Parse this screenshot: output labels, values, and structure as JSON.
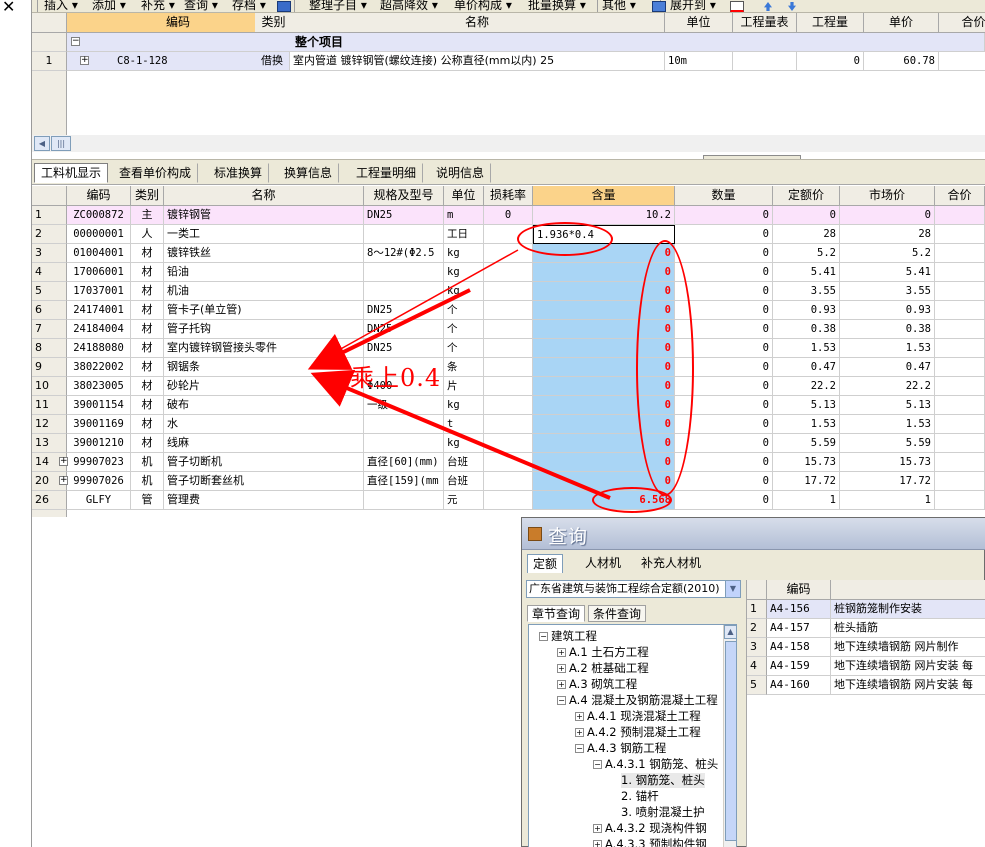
{
  "toolbar": {
    "close_glyph": "✕",
    "items": [
      "插入 ▾",
      "添加 ▾",
      "补充 ▾",
      "查询 ▾",
      "存档 ▾",
      "整理子目 ▾",
      "超高降效 ▾",
      "单价构成 ▾",
      "批量换算 ▾",
      "其他 ▾",
      "展开到 ▾"
    ]
  },
  "top_grid": {
    "headers": [
      "编码",
      "类别",
      "名称",
      "单位",
      "工程量表",
      "工程量",
      "单价",
      "合价"
    ],
    "group_row": {
      "expander": "−",
      "name": "整个项目"
    },
    "rows": [
      {
        "num": "1",
        "expander": "+",
        "code": "C8-1-128",
        "type": "借换",
        "name": "室内管道 镀锌钢管(螺纹连接) 公称直径(mm以内) 25",
        "unit": "10m",
        "qty": "0",
        "price": "60.78"
      }
    ]
  },
  "hscroll": {
    "left_arrow": "◀",
    "grip": "|||"
  },
  "tabs": [
    "工料机显示",
    "查看单价构成",
    "标准换算",
    "换算信息",
    "工程量明细",
    "说明信息"
  ],
  "material_grid": {
    "headers": [
      "编码",
      "类别",
      "名称",
      "规格及型号",
      "单位",
      "损耗率",
      "含量",
      "数量",
      "定额价",
      "市场价",
      "合价"
    ],
    "rows": [
      {
        "num": "1",
        "code": "ZC000872",
        "type": "主",
        "name": "镀锌钢管",
        "spec": "DN25",
        "unit": "m",
        "loss": "0",
        "content": "10.2",
        "qty": "0",
        "base": "0",
        "market": "0"
      },
      {
        "num": "2",
        "code": "00000001",
        "type": "人",
        "name": "一类工",
        "spec": "",
        "unit": "工日",
        "loss": "",
        "content": "1.936*0.4",
        "qty": "0",
        "base": "28",
        "market": "28"
      },
      {
        "num": "3",
        "code": "01004001",
        "type": "材",
        "name": "镀锌铁丝",
        "spec": "8～12#(Φ2.5",
        "unit": "kg",
        "loss": "",
        "content": "0",
        "qty": "0",
        "base": "5.2",
        "market": "5.2"
      },
      {
        "num": "4",
        "code": "17006001",
        "type": "材",
        "name": "铅油",
        "spec": "",
        "unit": "kg",
        "loss": "",
        "content": "0",
        "qty": "0",
        "base": "5.41",
        "market": "5.41"
      },
      {
        "num": "5",
        "code": "17037001",
        "type": "材",
        "name": "机油",
        "spec": "",
        "unit": "kg",
        "loss": "",
        "content": "0",
        "qty": "0",
        "base": "3.55",
        "market": "3.55"
      },
      {
        "num": "6",
        "code": "24174001",
        "type": "材",
        "name": "管卡子(单立管)",
        "spec": "DN25",
        "unit": "个",
        "loss": "",
        "content": "0",
        "qty": "0",
        "base": "0.93",
        "market": "0.93"
      },
      {
        "num": "7",
        "code": "24184004",
        "type": "材",
        "name": "管子托钩",
        "spec": "DN25",
        "unit": "个",
        "loss": "",
        "content": "0",
        "qty": "0",
        "base": "0.38",
        "market": "0.38"
      },
      {
        "num": "8",
        "code": "24188080",
        "type": "材",
        "name": "室内镀锌钢管接头零件",
        "spec": "DN25",
        "unit": "个",
        "loss": "",
        "content": "0",
        "qty": "0",
        "base": "1.53",
        "market": "1.53"
      },
      {
        "num": "9",
        "code": "38022002",
        "type": "材",
        "name": "钢锯条",
        "spec": "",
        "unit": "条",
        "loss": "",
        "content": "0",
        "qty": "0",
        "base": "0.47",
        "market": "0.47"
      },
      {
        "num": "10",
        "code": "38023005",
        "type": "材",
        "name": "砂轮片",
        "spec": "Φ400",
        "unit": "片",
        "loss": "",
        "content": "0",
        "qty": "0",
        "base": "22.2",
        "market": "22.2"
      },
      {
        "num": "11",
        "code": "39001154",
        "type": "材",
        "name": "破布",
        "spec": "一级",
        "unit": "kg",
        "loss": "",
        "content": "0",
        "qty": "0",
        "base": "5.13",
        "market": "5.13"
      },
      {
        "num": "12",
        "code": "39001169",
        "type": "材",
        "name": "水",
        "spec": "",
        "unit": "t",
        "loss": "",
        "content": "0",
        "qty": "0",
        "base": "1.53",
        "market": "1.53"
      },
      {
        "num": "13",
        "code": "39001210",
        "type": "材",
        "name": "线麻",
        "spec": "",
        "unit": "kg",
        "loss": "",
        "content": "0",
        "qty": "0",
        "base": "5.59",
        "market": "5.59"
      },
      {
        "num": "14",
        "expander": "+",
        "code": "99907023",
        "type": "机",
        "name": "管子切断机",
        "spec": "直径[60](mm)",
        "unit": "台班",
        "loss": "",
        "content": "0",
        "qty": "0",
        "base": "15.73",
        "market": "15.73"
      },
      {
        "num": "20",
        "expander": "+",
        "code": "99907026",
        "type": "机",
        "name": "管子切断套丝机",
        "spec": "直径[159](mm",
        "unit": "台班",
        "loss": "",
        "content": "0",
        "qty": "0",
        "base": "17.72",
        "market": "17.72"
      },
      {
        "num": "26",
        "code": "GLFY",
        "type": "管",
        "name": "管理费",
        "spec": "",
        "unit": "元",
        "loss": "",
        "content": "6.568",
        "qty": "0",
        "base": "1",
        "market": "1"
      }
    ]
  },
  "annotation": {
    "text": "乘上0.4"
  },
  "query": {
    "title": "查询",
    "tabs": [
      "定额",
      "人材机",
      "补充人材机"
    ],
    "selector": "广东省建筑与装饰工程综合定额(2010)",
    "selector_arrow": "▼",
    "sub_tabs": [
      "章节查询",
      "条件查询"
    ],
    "tree": [
      {
        "box": "−",
        "label": "建筑工程"
      },
      {
        "box": "+",
        "label": "A.1 土石方工程"
      },
      {
        "box": "+",
        "label": "A.2 桩基础工程"
      },
      {
        "box": "+",
        "label": "A.3 砌筑工程"
      },
      {
        "box": "−",
        "label": "A.4 混凝土及钢筋混凝土工程"
      },
      {
        "box": "+",
        "label": "A.4.1 现浇混凝土工程"
      },
      {
        "box": "+",
        "label": "A.4.2 预制混凝土工程"
      },
      {
        "box": "−",
        "label": "A.4.3 钢筋工程"
      },
      {
        "box": "−",
        "label": "A.4.3.1 钢筋笼、桩头"
      },
      {
        "box": "",
        "label": "1. 钢筋笼、桩头"
      },
      {
        "box": "",
        "label": "2. 锚杆"
      },
      {
        "box": "",
        "label": "3. 喷射混凝土护"
      },
      {
        "box": "+",
        "label": "A.4.3.2 现浇构件钢"
      },
      {
        "box": "+",
        "label": "A.4.3.3 预制构件钢"
      }
    ],
    "scroll_up": "▲",
    "grid_header": "编码",
    "grid_rows": [
      {
        "num": "1",
        "code": "A4-156",
        "name": "桩钢筋笼制作安装"
      },
      {
        "num": "2",
        "code": "A4-157",
        "name": "桩头插筋"
      },
      {
        "num": "3",
        "code": "A4-158",
        "name": "地下连续墙钢筋 网片制作"
      },
      {
        "num": "4",
        "code": "A4-159",
        "name": "地下连续墙钢筋 网片安装 每"
      },
      {
        "num": "5",
        "code": "A4-160",
        "name": "地下连续墙钢筋 网片安装 每"
      }
    ]
  },
  "colors": {
    "highlight_header": "#fbd38a",
    "content_col": "#a9d5f5",
    "annotation": "#ff0000",
    "main_row": "#fbe3fb"
  }
}
